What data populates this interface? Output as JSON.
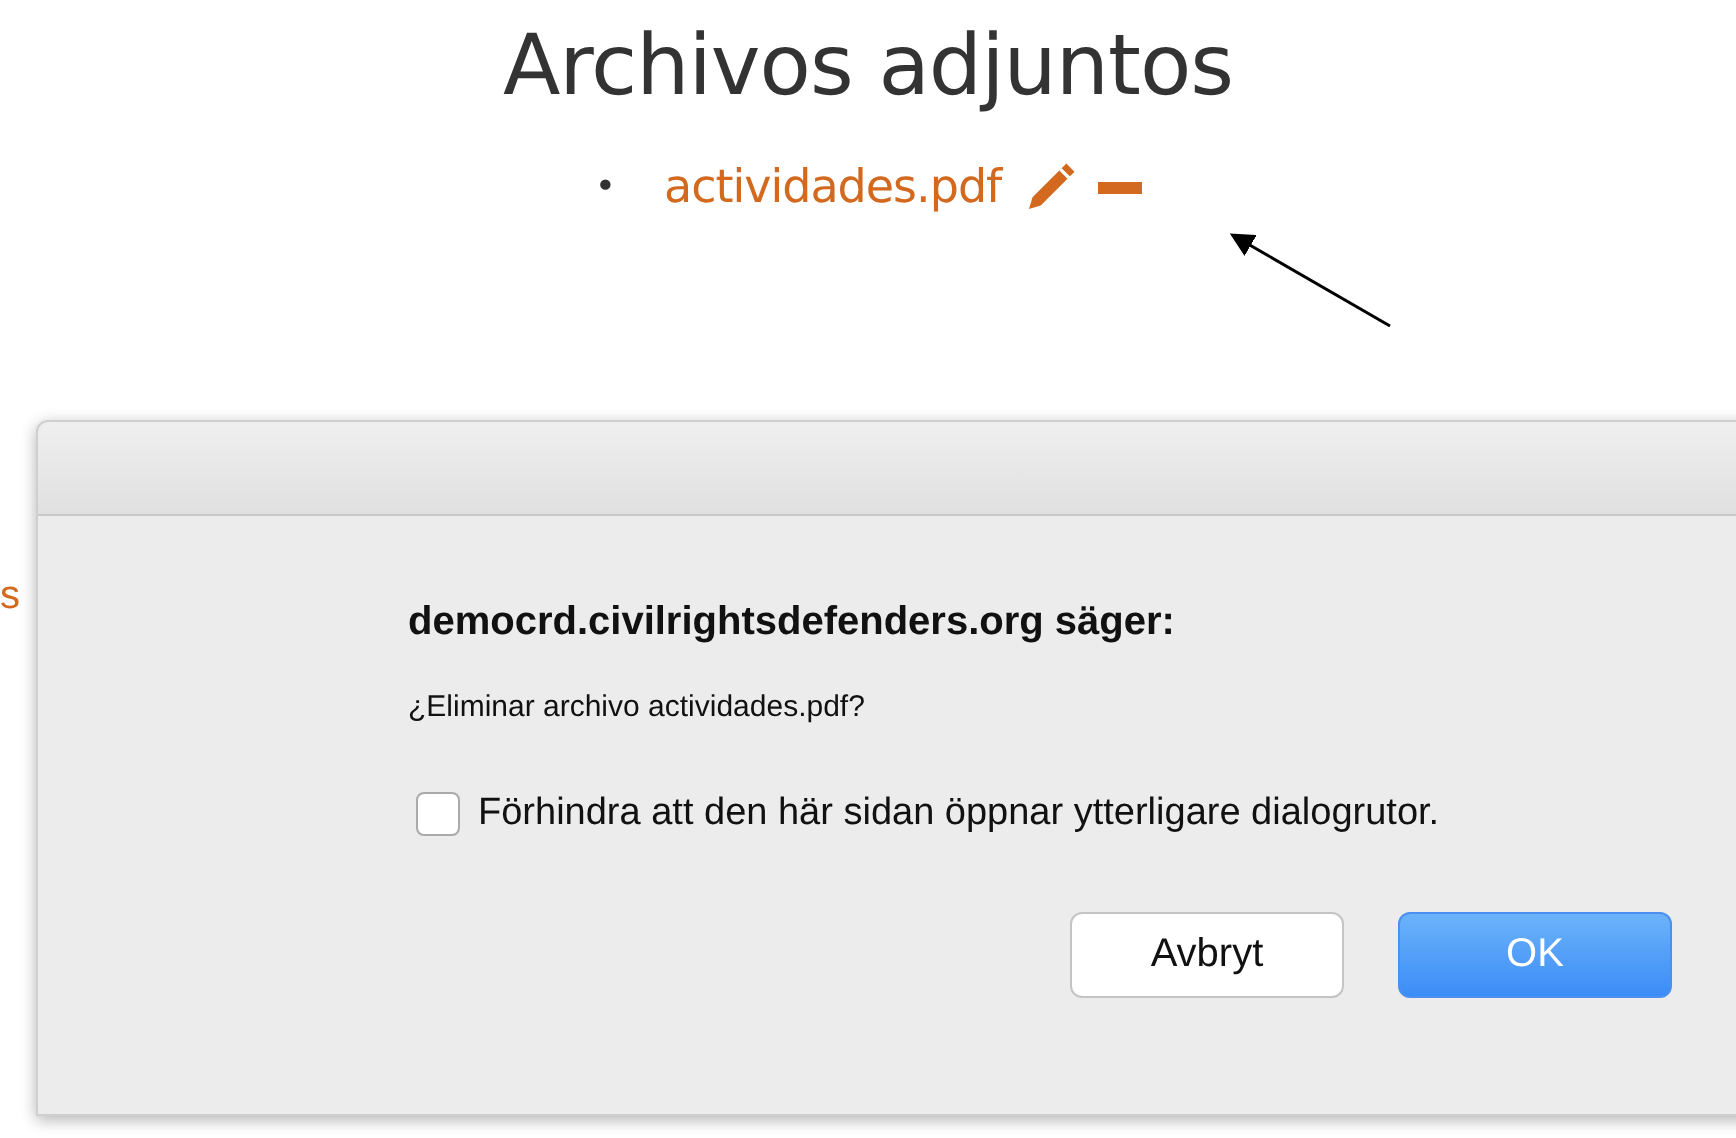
{
  "page": {
    "heading": "Archivos adjuntos",
    "attachments": [
      {
        "bullet": "•",
        "name": "actividades.pdf"
      }
    ],
    "side_fragment": "s"
  },
  "dialog": {
    "title": "democrd.civilrightsdefenders.org säger:",
    "message": "¿Eliminar archivo actividades.pdf?",
    "checkbox": {
      "label": "Förhindra att den här sidan öppnar ytterligare dialogrutor.",
      "checked": false
    },
    "buttons": [
      {
        "label": "Avbryt",
        "kind": "secondary"
      },
      {
        "label": "OK",
        "kind": "primary"
      }
    ]
  }
}
